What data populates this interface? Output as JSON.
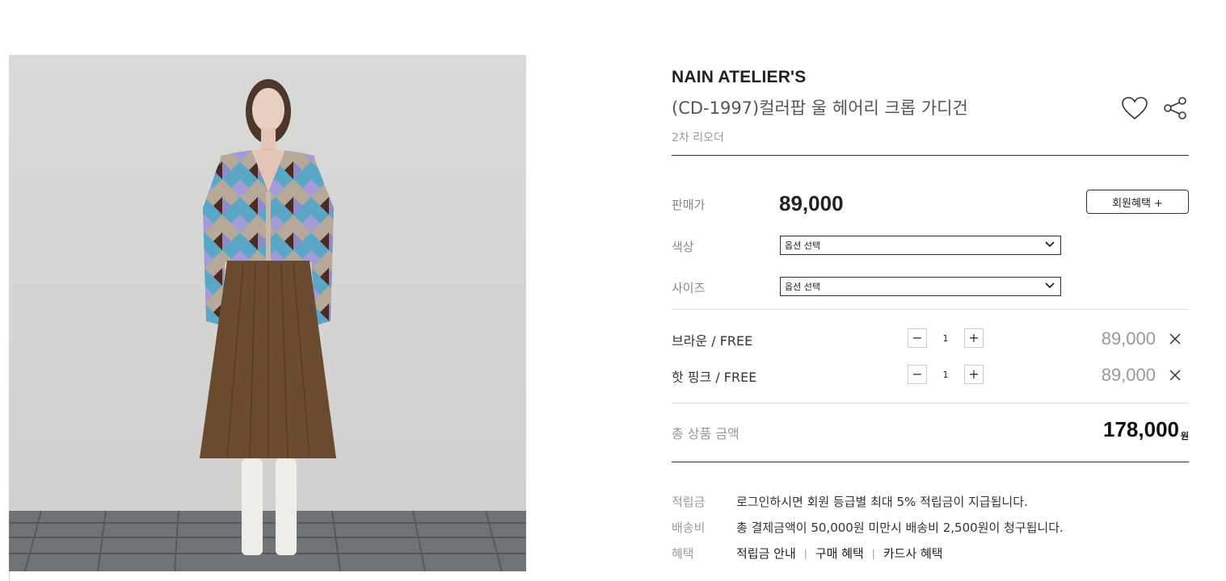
{
  "product": {
    "brand": "NAIN ATELIER'S",
    "title": "(CD-1997)컬러팝 울 헤어리 크롭 가디건",
    "subtitle": "2차 리오더",
    "image_alt": "product photo"
  },
  "icons": {
    "wishlist": "heart-icon",
    "share": "share-icon"
  },
  "price": {
    "label": "판매가",
    "value": "89,000",
    "member_button": "회원혜택 +"
  },
  "options": {
    "color": {
      "label": "색상",
      "placeholder": "옵션 선택"
    },
    "size": {
      "label": "사이즈",
      "placeholder": "옵션 선택"
    }
  },
  "selected_items": [
    {
      "name": "브라운 / FREE",
      "qty": "1",
      "price": "89,000"
    },
    {
      "name": "핫 핑크 / FREE",
      "qty": "1",
      "price": "89,000"
    }
  ],
  "total": {
    "label": "총 상품 금액",
    "value": "178,000",
    "unit": "원"
  },
  "info": {
    "points_label": "적립금",
    "points_text": "로그인하시면 회원 등급별 최대 5% 적립금이 지급됩니다.",
    "shipping_label": "배송비",
    "shipping_text": "총 결제금액이 50,000원 미만시 배송비 2,500원이 청구됩니다.",
    "benefit_label": "혜택",
    "benefit_links": [
      "적립금 안내",
      "구매 혜택",
      "카드사 혜택"
    ]
  }
}
